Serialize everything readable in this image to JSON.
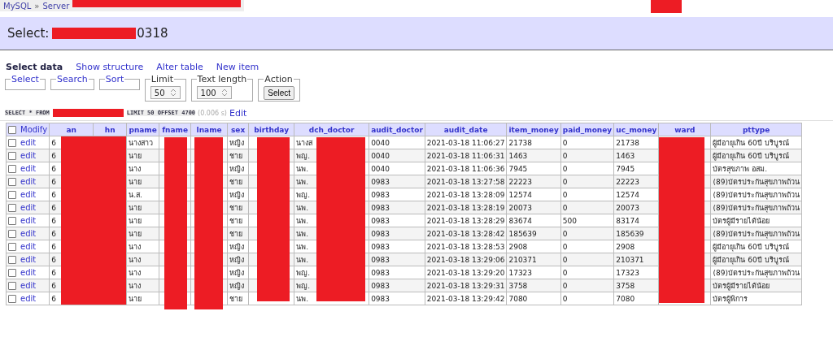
{
  "breadcrumb": {
    "items": [
      "MySQL",
      "Server"
    ],
    "separator": "»"
  },
  "title": {
    "label": "Select:",
    "suffix": "0318"
  },
  "nav": [
    {
      "label": "Select data",
      "selected": true
    },
    {
      "label": "Show structure",
      "selected": false
    },
    {
      "label": "Alter table",
      "selected": false
    },
    {
      "label": "New item",
      "selected": false
    }
  ],
  "filters": [
    {
      "kind": "link",
      "legend": "Select"
    },
    {
      "kind": "link",
      "legend": "Search"
    },
    {
      "kind": "link",
      "legend": "Sort"
    },
    {
      "kind": "number",
      "legend": "Limit",
      "value": "50"
    },
    {
      "kind": "number",
      "legend": "Text length",
      "value": "100"
    },
    {
      "kind": "button",
      "legend": "Action",
      "button": "Select"
    }
  ],
  "query": {
    "select": "SELECT * FROM",
    "limit": "LIMIT 50 OFFSET 4700",
    "time": "(0.006 s)",
    "edit": "Edit"
  },
  "table": {
    "all_checked": false,
    "modify": "Modify",
    "columns": [
      "an",
      "hn",
      "pname",
      "fname",
      "lname",
      "sex",
      "birthday",
      "dch_doctor",
      "audit_doctor",
      "audit_date",
      "item_money",
      "paid_money",
      "uc_money",
      "ward",
      "pttype"
    ],
    "rows": [
      {
        "checked": false,
        "edit": "edit",
        "cells": [
          "6",
          "",
          "นางสาว",
          "",
          "",
          "หญิง",
          "",
          "นางส",
          "0040",
          "2021-03-18 11:06:27",
          "21738",
          "0",
          "21738",
          "",
          "ผู้มีอายุเกิน 60ปี บริบูรณ์"
        ]
      },
      {
        "checked": false,
        "edit": "edit",
        "cells": [
          "6",
          "",
          "นาย",
          "",
          "",
          "ชาย",
          "",
          "พญ.",
          "0040",
          "2021-03-18 11:06:31",
          "1463",
          "0",
          "1463",
          "",
          "ผู้มีอายุเกิน 60ปี บริบูรณ์"
        ]
      },
      {
        "checked": false,
        "edit": "edit",
        "cells": [
          "6",
          "",
          "นาง",
          "",
          "",
          "หญิง",
          "",
          "นพ.",
          "0040",
          "2021-03-18 11:06:36",
          "7945",
          "0",
          "7945",
          "",
          "บัตรสุขภาพ อสม."
        ]
      },
      {
        "checked": false,
        "edit": "edit",
        "cells": [
          "6",
          "",
          "นาย",
          "",
          "",
          "ชาย",
          "",
          "นพ.",
          "0983",
          "2021-03-18 13:27:58",
          "22223",
          "0",
          "22223",
          "",
          "(89)บัตรประกันสุขภาพถ้วน"
        ]
      },
      {
        "checked": false,
        "edit": "edit",
        "cells": [
          "6",
          "",
          "น.ส.",
          "",
          "",
          "หญิง",
          "",
          "พญ.",
          "0983",
          "2021-03-18 13:28:09",
          "12574",
          "0",
          "12574",
          "",
          "(89)บัตรประกันสุขภาพถ้วน"
        ]
      },
      {
        "checked": false,
        "edit": "edit",
        "cells": [
          "6",
          "",
          "นาย",
          "",
          "",
          "ชาย",
          "",
          "นพ.",
          "0983",
          "2021-03-18 13:28:19",
          "20073",
          "0",
          "20073",
          "",
          "(89)บัตรประกันสุขภาพถ้วน"
        ]
      },
      {
        "checked": false,
        "edit": "edit",
        "cells": [
          "6",
          "",
          "นาย",
          "",
          "",
          "ชาย",
          "",
          "นพ.",
          "0983",
          "2021-03-18 13:28:29",
          "83674",
          "500",
          "83174",
          "",
          "บัตรผู้มีรายได้น้อย"
        ]
      },
      {
        "checked": false,
        "edit": "edit",
        "cells": [
          "6",
          "",
          "นาย",
          "",
          "",
          "ชาย",
          "",
          "นพ.",
          "0983",
          "2021-03-18 13:28:42",
          "185639",
          "0",
          "185639",
          "",
          "(89)บัตรประกันสุขภาพถ้วน"
        ]
      },
      {
        "checked": false,
        "edit": "edit",
        "cells": [
          "6",
          "",
          "นาง",
          "",
          "",
          "หญิง",
          "",
          "นพ.",
          "0983",
          "2021-03-18 13:28:53",
          "2908",
          "0",
          "2908",
          "",
          "ผู้มีอายุเกิน 60ปี บริบูรณ์"
        ]
      },
      {
        "checked": false,
        "edit": "edit",
        "cells": [
          "6",
          "",
          "นาง",
          "",
          "",
          "หญิง",
          "",
          "นพ.",
          "0983",
          "2021-03-18 13:29:06",
          "210371",
          "0",
          "210371",
          "",
          "ผู้มีอายุเกิน 60ปี บริบูรณ์"
        ]
      },
      {
        "checked": false,
        "edit": "edit",
        "cells": [
          "6",
          "",
          "นาง",
          "",
          "",
          "หญิง",
          "",
          "พญ.",
          "0983",
          "2021-03-18 13:29:20",
          "17323",
          "0",
          "17323",
          "",
          "(89)บัตรประกันสุขภาพถ้วน"
        ]
      },
      {
        "checked": false,
        "edit": "edit",
        "cells": [
          "6",
          "",
          "นาง",
          "",
          "",
          "หญิง",
          "",
          "พญ.",
          "0983",
          "2021-03-18 13:29:31",
          "3758",
          "0",
          "3758",
          "",
          "บัตรผู้มีรายได้น้อย"
        ]
      },
      {
        "checked": false,
        "edit": "edit",
        "cells": [
          "6",
          "",
          "นาย",
          "",
          "",
          "ชาย",
          "",
          "นพ.",
          "0983",
          "2021-03-18 13:29:42",
          "7080",
          "0",
          "7080",
          "",
          "บัตรผู้พิการ"
        ]
      }
    ]
  }
}
